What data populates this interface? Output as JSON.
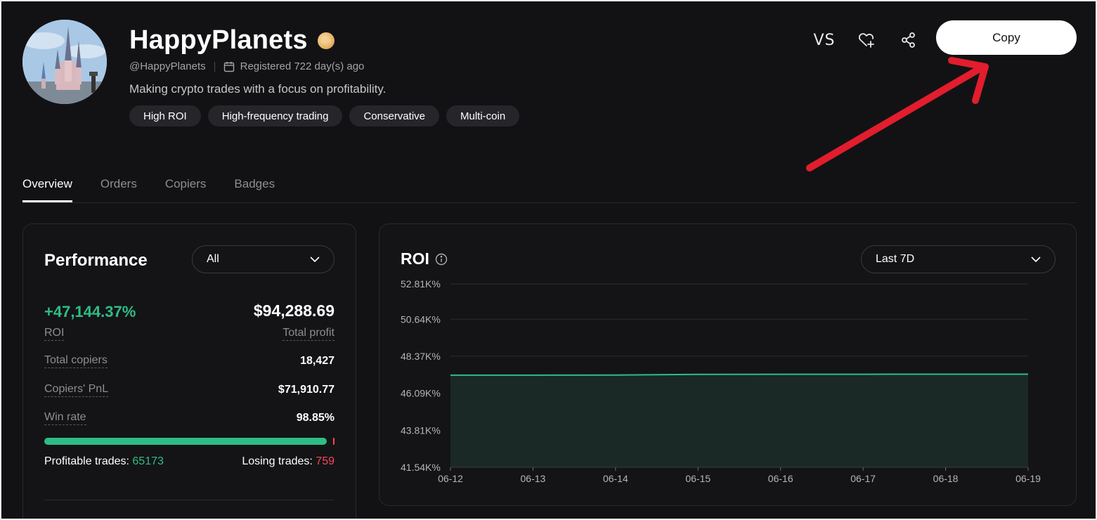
{
  "profile": {
    "name": "HappyPlanets",
    "handle": "@HappyPlanets",
    "registered": "Registered 722 day(s) ago",
    "bio": "Making crypto trades with a focus on profitability.",
    "tags": [
      "High ROI",
      "High-frequency trading",
      "Conservative",
      "Multi-coin"
    ]
  },
  "header": {
    "vs_label": "VS",
    "copy_label": "Copy"
  },
  "tabs": [
    {
      "label": "Overview",
      "active": true
    },
    {
      "label": "Orders",
      "active": false
    },
    {
      "label": "Copiers",
      "active": false
    },
    {
      "label": "Badges",
      "active": false
    }
  ],
  "performance": {
    "title": "Performance",
    "filter": "All",
    "roi_value": "+47,144.37%",
    "roi_label": "ROI",
    "profit_value": "$94,288.69",
    "profit_label": "Total profit",
    "rows": [
      {
        "label": "Total copiers",
        "value": "18,427"
      },
      {
        "label": "Copiers' PnL",
        "value": "$71,910.77"
      },
      {
        "label": "Win rate",
        "value": "98.85%"
      }
    ],
    "win_fraction": 0.9885,
    "profitable_label": "Profitable trades:",
    "profitable_count": "65173",
    "losing_label": "Losing trades:",
    "losing_count": "759"
  },
  "roi_chart": {
    "title": "ROI",
    "range": "Last 7D"
  },
  "colors": {
    "accent_green": "#2ebd85",
    "loss_red": "#f6465d",
    "annotation_arrow": "#e11d2e"
  },
  "icons": [
    "calendar-icon",
    "heart-plus-icon",
    "share-icon",
    "chevron-down-icon",
    "info-icon"
  ],
  "chart_data": {
    "type": "area",
    "title": "",
    "xlabel": "",
    "ylabel": "",
    "x": [
      "06-12",
      "06-13",
      "06-14",
      "06-15",
      "06-16",
      "06-17",
      "06-18",
      "06-19"
    ],
    "series": [
      {
        "values": [
          47200,
          47200,
          47210,
          47250,
          47255,
          47258,
          47260,
          47262
        ]
      }
    ],
    "y_ticks": [
      "52.81K%",
      "50.64K%",
      "48.37K%",
      "46.09K%",
      "43.81K%",
      "41.54K%"
    ],
    "y_tick_values": [
      52810,
      50640,
      48370,
      46090,
      43810,
      41540
    ],
    "ylim": [
      41540,
      52810
    ],
    "grid": true
  }
}
